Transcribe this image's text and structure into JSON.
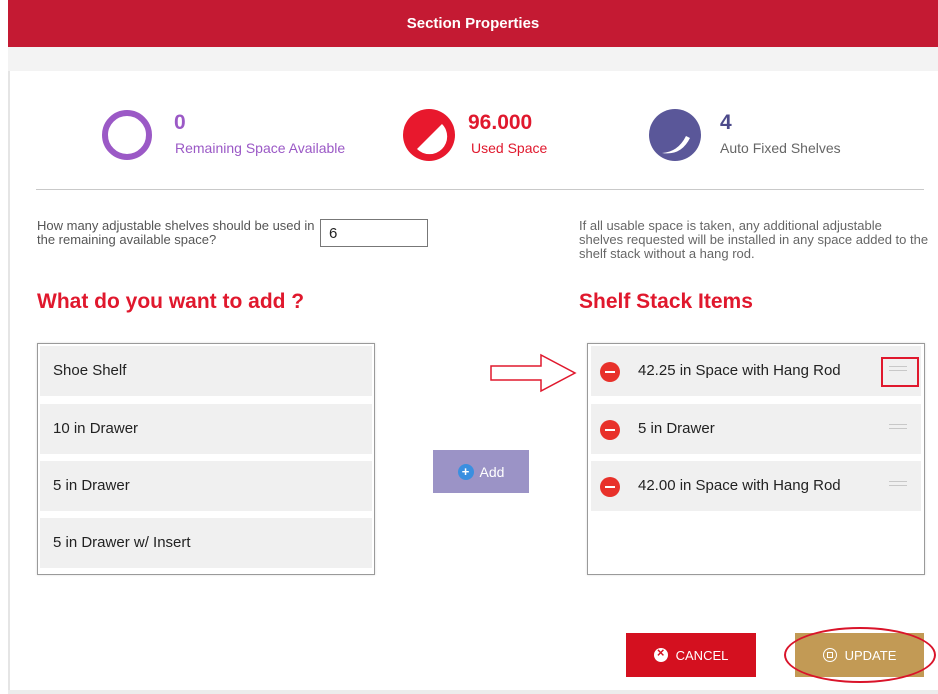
{
  "header": {
    "title": "Section Properties"
  },
  "stats": {
    "remaining": {
      "value": "0",
      "label": "Remaining Space Available",
      "color": "#9b59c6",
      "icon": "ring-icon"
    },
    "used": {
      "value": "96.000",
      "label": "Used Space",
      "color": "#e0182d",
      "icon": "pie-gauge-icon"
    },
    "shelves": {
      "value": "4",
      "label": "Auto Fixed Shelves",
      "color": "#4c4a8a",
      "icon": "pie-gauge-icon"
    }
  },
  "question": {
    "text": "How many adjustable shelves should be used in the remaining available space?",
    "value": "6"
  },
  "note": "If all usable space is taken, any additional adjustable shelves requested will be installed in any space added to the shelf stack without a hang rod.",
  "add_section": {
    "heading": "What do you want to add ?",
    "options": [
      "Shoe Shelf",
      "10 in Drawer",
      "5 in Drawer",
      "5 in Drawer w/ Insert"
    ]
  },
  "add_button": {
    "label": "Add"
  },
  "stack_section": {
    "heading": "Shelf Stack Items",
    "items": [
      "42.25 in Space with Hang Rod",
      "5 in Drawer",
      "42.00 in Space with Hang Rod"
    ]
  },
  "buttons": {
    "cancel": "CANCEL",
    "update": "UPDATE"
  },
  "colors": {
    "brand_red": "#c41a33",
    "heading_red": "#e0182d",
    "add_button": "#9b93c6",
    "update_button": "#c29a55"
  }
}
